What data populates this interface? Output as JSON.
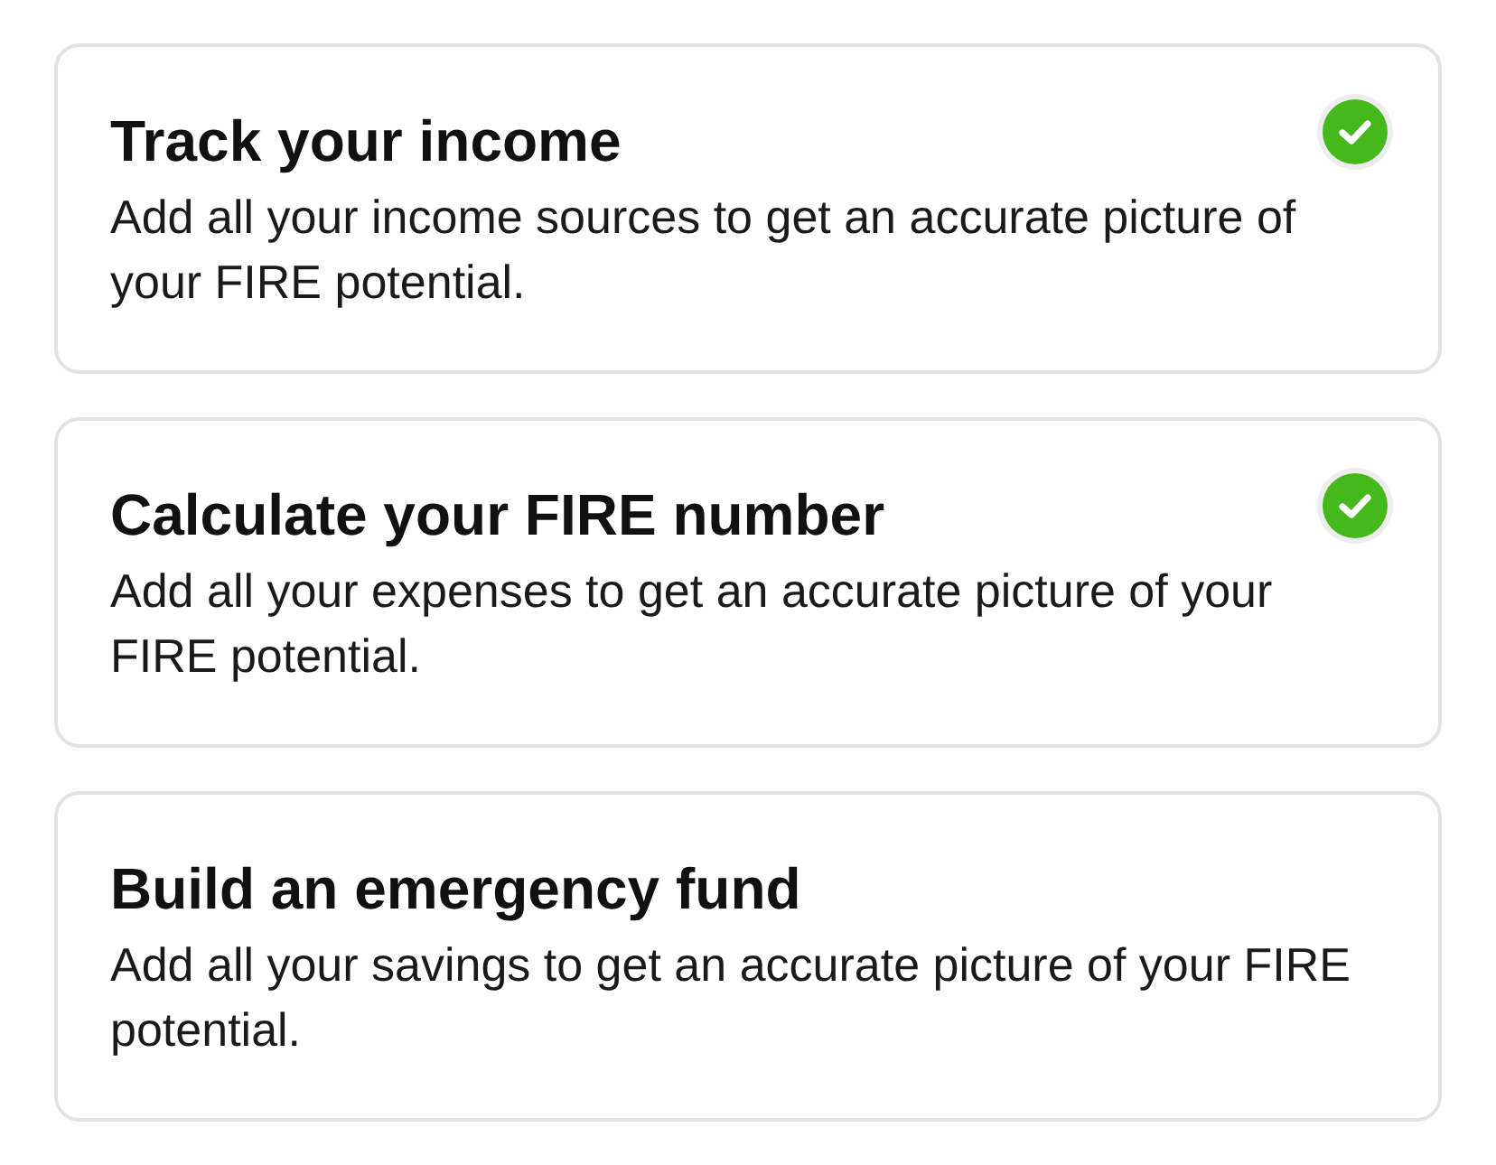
{
  "steps": [
    {
      "title": "Track your income",
      "description": "Add all your income sources to get an accurate picture of your FIRE potential.",
      "completed": true
    },
    {
      "title": "Calculate your FIRE number",
      "description": "Add all your expenses to get an accurate picture of your FIRE potential.",
      "completed": true
    },
    {
      "title": "Build an emergency fund",
      "description": "Add all your savings to get an accurate picture of your FIRE potential.",
      "completed": false
    }
  ]
}
